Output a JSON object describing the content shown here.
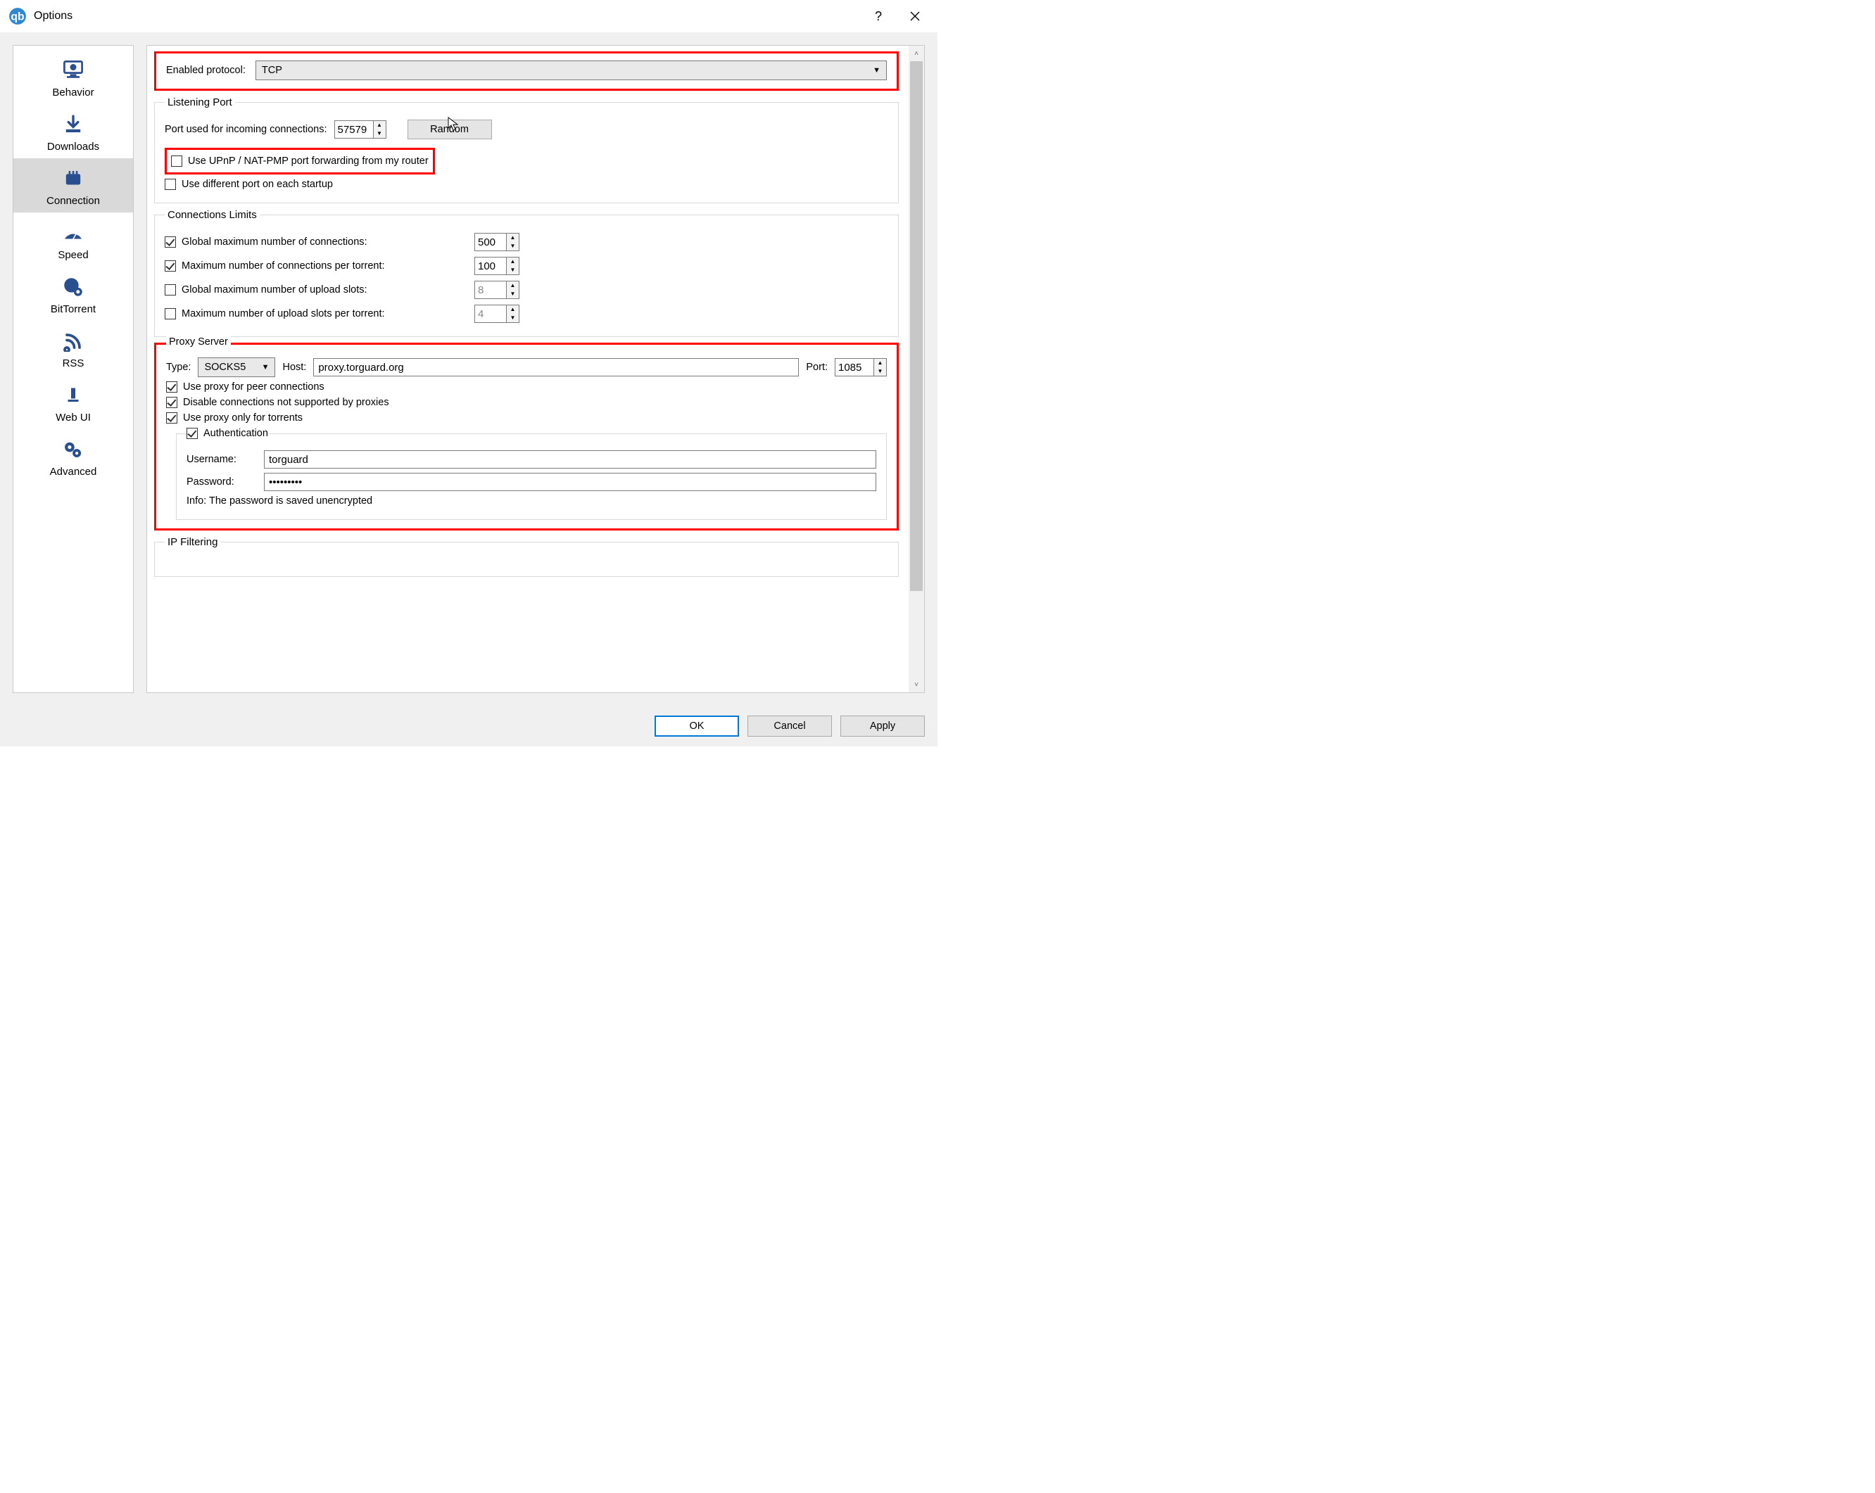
{
  "window": {
    "title": "Options"
  },
  "sidebar": {
    "items": [
      {
        "label": "Behavior"
      },
      {
        "label": "Downloads"
      },
      {
        "label": "Connection"
      },
      {
        "label": "Speed"
      },
      {
        "label": "BitTorrent"
      },
      {
        "label": "RSS"
      },
      {
        "label": "Web UI"
      },
      {
        "label": "Advanced"
      }
    ],
    "selected": 2
  },
  "protocol": {
    "label": "Enabled protocol:",
    "value": "TCP"
  },
  "listening": {
    "legend": "Listening Port",
    "port_label": "Port used for incoming connections:",
    "port_value": "57579",
    "random_button": "Random",
    "upnp": {
      "checked": false,
      "label": "Use UPnP / NAT-PMP port forwarding from my router"
    },
    "diffport": {
      "checked": false,
      "label": "Use different port on each startup"
    }
  },
  "limits": {
    "legend": "Connections Limits",
    "global_conn": {
      "checked": true,
      "label": "Global maximum number of connections:",
      "value": "500"
    },
    "per_torrent": {
      "checked": true,
      "label": "Maximum number of connections per torrent:",
      "value": "100"
    },
    "global_slots": {
      "checked": false,
      "label": "Global maximum number of upload slots:",
      "value": "8"
    },
    "slots_per_torrent": {
      "checked": false,
      "label": "Maximum number of upload slots per torrent:",
      "value": "4"
    }
  },
  "proxy": {
    "legend": "Proxy Server",
    "type_label": "Type:",
    "type_value": "SOCKS5",
    "host_label": "Host:",
    "host_value": "proxy.torguard.org",
    "port_label": "Port:",
    "port_value": "1085",
    "peer": {
      "checked": true,
      "label": "Use proxy for peer connections"
    },
    "disable": {
      "checked": true,
      "label": "Disable connections not supported by proxies"
    },
    "torrents_only": {
      "checked": true,
      "label": "Use proxy only for torrents"
    },
    "auth": {
      "checked": true,
      "label": "Authentication"
    },
    "user_label": "Username:",
    "user_value": "torguard",
    "pass_label": "Password:",
    "pass_value": "•••••••••",
    "info": "Info: The password is saved unencrypted"
  },
  "ipfilter": {
    "legend": "IP Filtering"
  },
  "footer": {
    "ok": "OK",
    "cancel": "Cancel",
    "apply": "Apply"
  }
}
